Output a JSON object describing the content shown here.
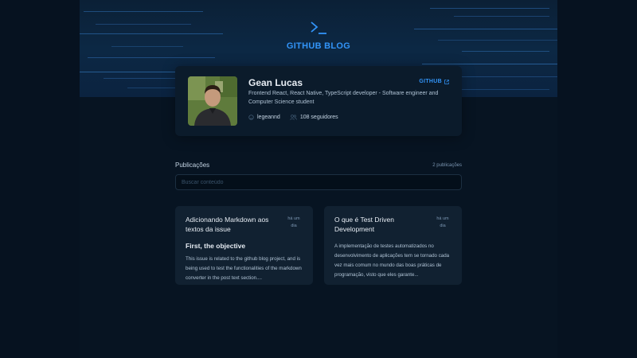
{
  "header": {
    "logo_icon": "terminal-icon",
    "title": "GITHUB BLOG",
    "accent": "#3294f8"
  },
  "profile": {
    "name": "Gean Lucas",
    "github_label": "GITHUB",
    "bio": "Frontend React, React Native, TypeScript developer - Software engineer and Computer Science student",
    "username": "legeannd",
    "followers": "108 seguidores"
  },
  "publications": {
    "label": "Publicações",
    "count": "2 publicações",
    "search_placeholder": "Buscar conteúdo"
  },
  "posts": [
    {
      "title": "Adicionando Markdown aos textos da issue",
      "date": "há um dia",
      "heading": "First, the objective",
      "excerpt": "This issue is related to the github blog project, and is being used to test the functionalities of the markdown converter in the post text section...."
    },
    {
      "title": "O que é Test Driven Development",
      "date": "há um dia",
      "heading": "",
      "excerpt": "A implementação de testes automatizados no desenvolvimento de aplicações tem se tornado cada vez mais comum no mundo das boas práticas de programação, visto que eles garante..."
    }
  ]
}
